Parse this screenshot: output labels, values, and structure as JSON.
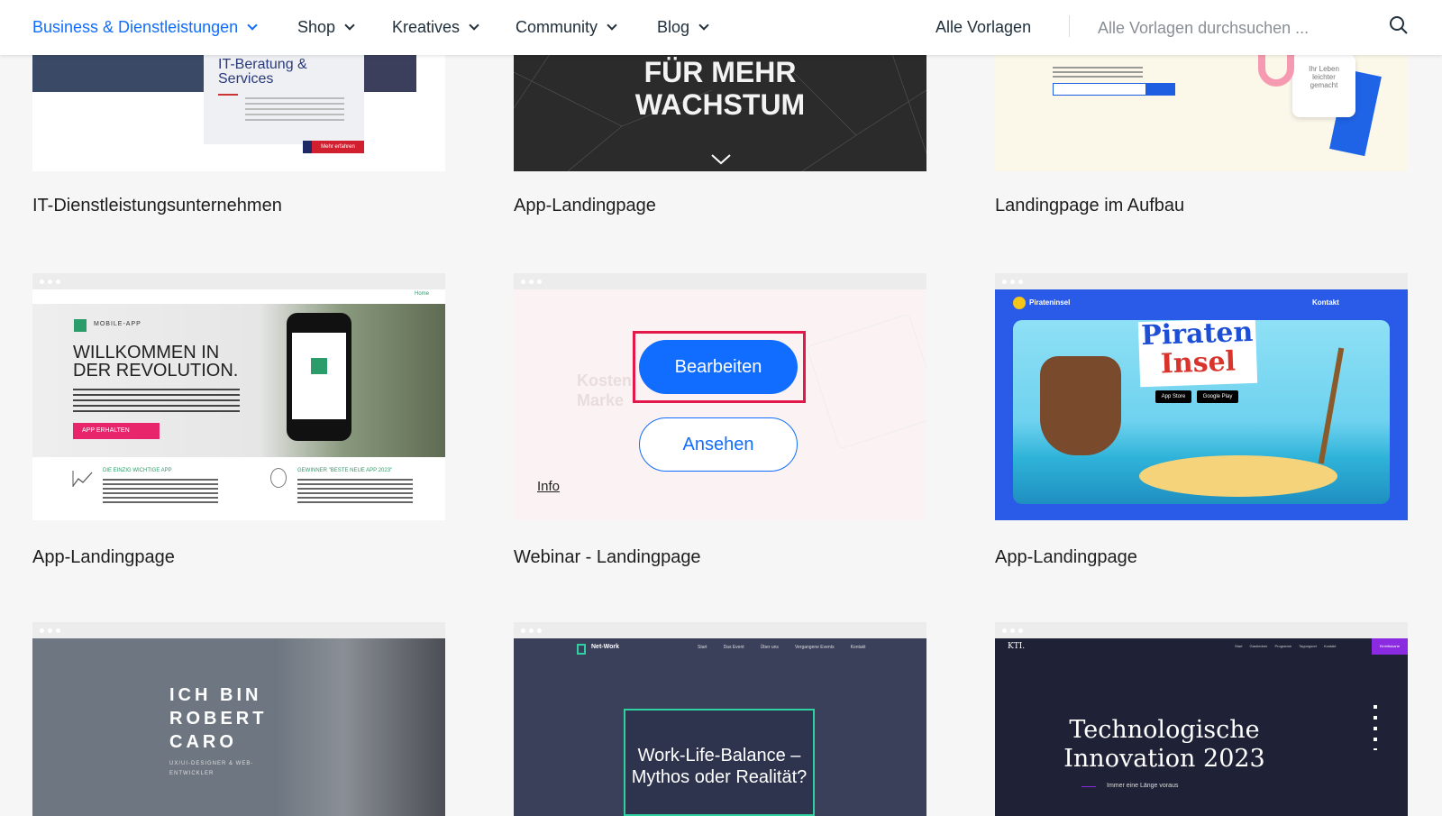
{
  "nav": {
    "items": [
      {
        "label": "Business & Dienstleistungen",
        "active": true
      },
      {
        "label": "Shop"
      },
      {
        "label": "Kreatives"
      },
      {
        "label": "Community"
      },
      {
        "label": "Blog"
      }
    ],
    "all_templates": "Alle Vorlagen",
    "search_placeholder": "Alle Vorlagen durchsuchen ..."
  },
  "row1": [
    {
      "title": "IT-Dienstleistungsunternehmen",
      "thumb_heading": "IT-Beratung & Services",
      "thumb_button": "Mehr erfahren"
    },
    {
      "title": "App-Landingpage",
      "thumb_heading": "FÜR MEHR WACHSTUM"
    },
    {
      "title": "Landingpage im Aufbau",
      "thumb_note": "Ihr Leben leichter gemacht"
    }
  ],
  "row2": [
    {
      "title": "App-Landingpage",
      "thumb_tag": "MOBILE-APP",
      "thumb_heading": "WILLKOMMEN IN DER REVOLUTION.",
      "thumb_button": "APP ERHALTEN",
      "thumb_nav": "Home",
      "thumb_col1": "DIE EINZIG WICHTIGE APP",
      "thumb_col2": "GEWINNER \"BESTE NEUE APP 2023\""
    },
    {
      "title": "Webinar - Landingpage",
      "edit_label": "Bearbeiten",
      "view_label": "Ansehen",
      "info_label": "Info",
      "thumb_heading": "Kosten Marke"
    },
    {
      "title": "App-Landingpage",
      "thumb_brand": "Pirateninsel",
      "thumb_nav": "Kontakt",
      "thumb_heading1": "Piraten",
      "thumb_heading2": "Insel",
      "store1": "App Store",
      "store2": "Google Play"
    }
  ],
  "row3": [
    {
      "thumb_heading": "ICH BIN ROBERT CARO",
      "thumb_sub": "UX/UI-DESIGNER & WEB-ENTWICKLER"
    },
    {
      "thumb_brand": "Net-Work",
      "thumb_nav": [
        "Start",
        "Das Event",
        "Über uns",
        "Vergangene Events",
        "Kontakt"
      ],
      "thumb_heading": "Work-Life-Balance – Mythos oder Realität?"
    },
    {
      "thumb_brand": "KTI.",
      "thumb_nav": [
        "Start",
        "Gastredner",
        "Programm",
        "Tagungsort",
        "Kontakt"
      ],
      "thumb_button": "Eintrittskarte",
      "thumb_heading": "Technologische Innovation 2023",
      "thumb_sub": "Immer eine Länge voraus"
    }
  ],
  "colors": {
    "accent": "#116dff",
    "highlight": "#e3174a"
  }
}
